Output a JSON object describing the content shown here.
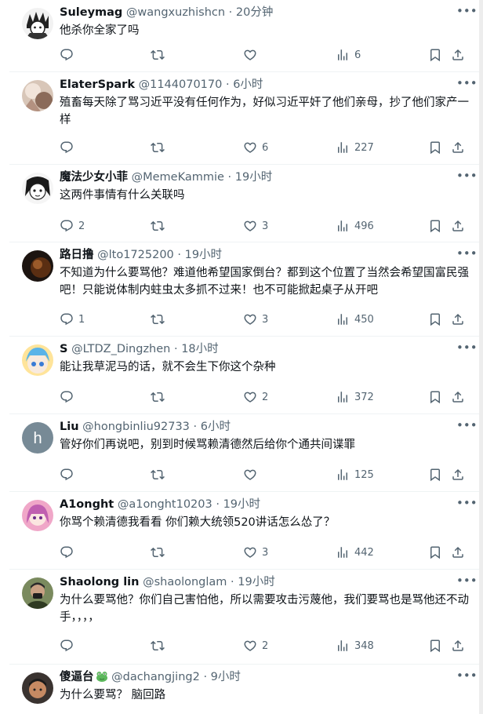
{
  "posts": [
    {
      "name": "Suleymag",
      "handle": "@wangxuzhishcn",
      "sep": "·",
      "time": "20分钟",
      "text": "他杀你全家了吗",
      "reply": "",
      "retweet": "",
      "like": "",
      "views": "6"
    },
    {
      "name": "ElaterSpark",
      "handle": "@1144070170",
      "sep": "·",
      "time": "6小时",
      "text": "殖畜每天除了骂习近平没有任何作为，好似习近平奸了他们亲母，抄了他们家产一样",
      "reply": "",
      "retweet": "",
      "like": "6",
      "views": "227"
    },
    {
      "name": "魔法少女小菲",
      "handle": "@MemeKammie",
      "sep": "·",
      "time": "19小时",
      "text": "这两件事情有什么关联吗",
      "reply": "2",
      "retweet": "",
      "like": "3",
      "views": "496"
    },
    {
      "name": "路日撸",
      "handle": "@lto1725200",
      "sep": "·",
      "time": "19小时",
      "text": "不知道为什么要骂他？难道他希望国家倒台？都到这个位置了当然会希望国富民强吧！只能说体制内蛀虫太多抓不过来！也不可能掀起桌子从开吧",
      "reply": "1",
      "retweet": "",
      "like": "3",
      "views": "450"
    },
    {
      "name": "S",
      "handle": "@LTDZ_Dingzhen",
      "sep": "·",
      "time": "18小时",
      "text": "能让我草泥马的话，就不会生下你这个杂种",
      "reply": "",
      "retweet": "",
      "like": "2",
      "views": "372"
    },
    {
      "name": "Liu",
      "handle": "@hongbinliu92733",
      "sep": "·",
      "time": "6小时",
      "text": "管好你们再说吧，别到时候骂赖清德然后给你个通共间谍罪",
      "reply": "",
      "retweet": "",
      "like": "",
      "views": "125"
    },
    {
      "name": "A1onght",
      "handle": "@a1onght10203",
      "sep": "·",
      "time": "19小时",
      "text": "你骂个赖清德我看看  你们赖大统领520讲话怎么怂了？",
      "reply": "",
      "retweet": "",
      "like": "3",
      "views": "442"
    },
    {
      "name": "Shaolong lin",
      "handle": "@shaolonglam",
      "sep": "·",
      "time": "19小时",
      "text": "为什么要骂他？你们自己害怕他，所以需要攻击污蔑他，我们要骂也是骂他还不动手，，，，",
      "reply": "",
      "retweet": "",
      "like": "2",
      "views": "348"
    },
    {
      "name": "傻逼台",
      "handle": "@dachangjing2",
      "sep": "·",
      "time": "9小时",
      "text": "为什么要骂？  脑回路",
      "reply": "",
      "retweet": "",
      "like": "",
      "views": ""
    }
  ],
  "colors": {
    "text": "#0f1419",
    "secondary": "#536471",
    "divider": "#eff3f4"
  },
  "icons": [
    "reply-icon",
    "retweet-icon",
    "like-icon",
    "views-icon",
    "bookmark-icon",
    "share-icon",
    "more-icon",
    "frog-emoji-icon"
  ]
}
